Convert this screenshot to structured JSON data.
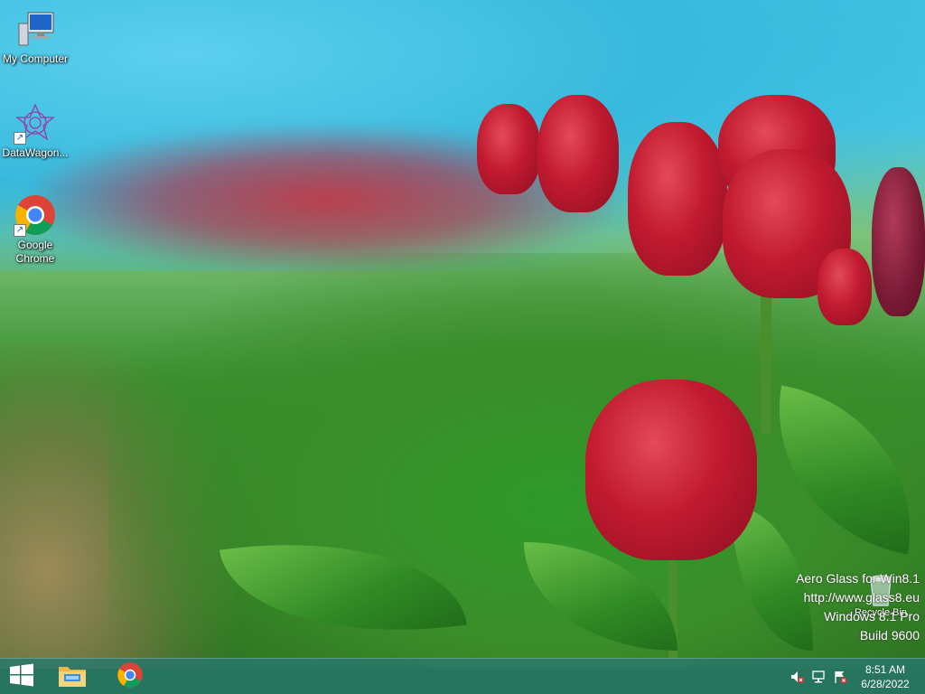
{
  "desktop_icons": [
    {
      "label": "My Computer",
      "icon": "computer-icon"
    },
    {
      "label": "DataWagon...",
      "icon": "datawagon-icon"
    },
    {
      "label": "Google Chrome",
      "icon": "chrome-icon"
    }
  ],
  "recycle_bin": {
    "label": "Recycle Bin",
    "icon": "recycle-bin-icon"
  },
  "watermark": {
    "line1": "Aero Glass for Win8.1",
    "line2": "http://www.glass8.eu",
    "line3": "Windows 8.1 Pro",
    "line4": "Build 9600"
  },
  "taskbar": {
    "start_icon": "windows-start-icon",
    "pinned": [
      {
        "name": "file-explorer-icon"
      },
      {
        "name": "chrome-icon"
      }
    ],
    "tray": {
      "icons": [
        "volume-muted-icon",
        "network-icon",
        "action-center-flag-icon"
      ],
      "time": "8:51 AM",
      "date": "6/28/2022"
    }
  },
  "colors": {
    "taskbar": "#287868",
    "chrome_red": "#db4437",
    "chrome_yellow": "#f4b400",
    "chrome_green": "#0f9d58",
    "chrome_blue": "#4285f4"
  }
}
